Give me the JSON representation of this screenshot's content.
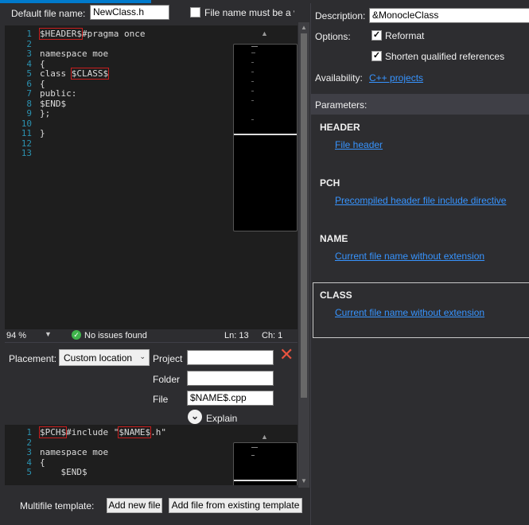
{
  "left": {
    "default_file_label": "Default file name:",
    "default_file_value": "NewClass.h",
    "must_be_valid_label": "File name must be a v",
    "editor1": {
      "line_numbers": [
        "1",
        "2",
        "3",
        "4",
        "5",
        "6",
        "7",
        "8",
        "9",
        "10",
        "11",
        "12",
        "13"
      ],
      "lines": [
        [
          {
            "t": "$HEADER$",
            "m": true
          },
          {
            "t": "#pragma once"
          }
        ],
        [],
        [
          {
            "t": "namespace moe"
          }
        ],
        [
          {
            "t": "{"
          }
        ],
        [
          {
            "t": "class "
          },
          {
            "t": "$CLASS$",
            "m": true
          }
        ],
        [
          {
            "t": "{"
          }
        ],
        [
          {
            "t": "public:"
          }
        ],
        [
          {
            "t": "$END$"
          }
        ],
        [
          {
            "t": "};"
          }
        ],
        [],
        [
          {
            "t": "}"
          }
        ],
        [],
        []
      ]
    },
    "status": {
      "zoom": "94 %",
      "issues": "No issues found",
      "line": "Ln: 13",
      "col": "Ch: 1"
    },
    "placement": {
      "label": "Placement:",
      "value": "Custom location",
      "project_label": "Project",
      "folder_label": "Folder",
      "file_label": "File",
      "file_value": "$NAME$.cpp",
      "explain": "Explain"
    },
    "editor2": {
      "line_numbers": [
        "1",
        "2",
        "3",
        "4",
        "5"
      ],
      "lines": [
        [
          {
            "t": "$PCH$",
            "m": true
          },
          {
            "t": "#include \""
          },
          {
            "t": "$NAME$",
            "m": true
          },
          {
            "t": ".h\""
          }
        ],
        [],
        [
          {
            "t": "namespace moe"
          }
        ],
        [
          {
            "t": "{"
          }
        ],
        [
          {
            "t": "    $END$"
          }
        ]
      ]
    },
    "multifile_label": "Multifile template:",
    "add_new_file": "Add new file",
    "add_existing": "Add file from existing template"
  },
  "right": {
    "description_label": "Description:",
    "description_value": "&MonocleClass",
    "options_label": "Options:",
    "reformat": "Reformat",
    "shorten": "Shorten qualified references",
    "availability_label": "Availability:",
    "availability_link": "C++ projects",
    "parameters_label": "Parameters:",
    "params": [
      {
        "name": "HEADER",
        "link": "File header"
      },
      {
        "name": "PCH",
        "link": "Precompiled header file include directive"
      },
      {
        "name": "NAME",
        "link": "Current file name without extension"
      },
      {
        "name": "CLASS",
        "link": "Current file name without extension"
      }
    ]
  }
}
